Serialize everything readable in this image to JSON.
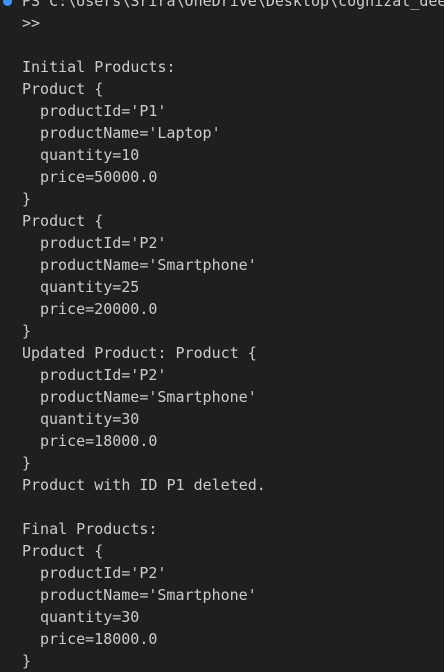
{
  "theme": {
    "background": "#1f1f1f",
    "foreground": "#cccccc",
    "command_decoration": "#3794ff"
  },
  "terminal": {
    "lines": [
      {
        "text": "PS C:\\Users\\Srira\\OneDrive\\Desktop\\cognizat_dee",
        "indent": false,
        "kind": "prompt"
      },
      {
        "text": ">>",
        "indent": false,
        "kind": "prompt"
      },
      {
        "text": "",
        "indent": false,
        "kind": "blank"
      },
      {
        "text": "Initial Products:",
        "indent": false,
        "kind": "output"
      },
      {
        "text": "Product {",
        "indent": false,
        "kind": "output"
      },
      {
        "text": "productId='P1'",
        "indent": true,
        "kind": "output"
      },
      {
        "text": "productName='Laptop'",
        "indent": true,
        "kind": "output"
      },
      {
        "text": "quantity=10",
        "indent": true,
        "kind": "output"
      },
      {
        "text": "price=50000.0",
        "indent": true,
        "kind": "output"
      },
      {
        "text": "}",
        "indent": false,
        "kind": "output"
      },
      {
        "text": "Product {",
        "indent": false,
        "kind": "output"
      },
      {
        "text": "productId='P2'",
        "indent": true,
        "kind": "output"
      },
      {
        "text": "productName='Smartphone'",
        "indent": true,
        "kind": "output"
      },
      {
        "text": "quantity=25",
        "indent": true,
        "kind": "output"
      },
      {
        "text": "price=20000.0",
        "indent": true,
        "kind": "output"
      },
      {
        "text": "}",
        "indent": false,
        "kind": "output"
      },
      {
        "text": "Updated Product: Product {",
        "indent": false,
        "kind": "output"
      },
      {
        "text": "productId='P2'",
        "indent": true,
        "kind": "output"
      },
      {
        "text": "productName='Smartphone'",
        "indent": true,
        "kind": "output"
      },
      {
        "text": "quantity=30",
        "indent": true,
        "kind": "output"
      },
      {
        "text": "price=18000.0",
        "indent": true,
        "kind": "output"
      },
      {
        "text": "}",
        "indent": false,
        "kind": "output"
      },
      {
        "text": "Product with ID P1 deleted.",
        "indent": false,
        "kind": "output"
      },
      {
        "text": "",
        "indent": false,
        "kind": "blank"
      },
      {
        "text": "Final Products:",
        "indent": false,
        "kind": "output"
      },
      {
        "text": "Product {",
        "indent": false,
        "kind": "output"
      },
      {
        "text": "productId='P2'",
        "indent": true,
        "kind": "output"
      },
      {
        "text": "productName='Smartphone'",
        "indent": true,
        "kind": "output"
      },
      {
        "text": "quantity=30",
        "indent": true,
        "kind": "output"
      },
      {
        "text": "price=18000.0",
        "indent": true,
        "kind": "output"
      },
      {
        "text": "}",
        "indent": false,
        "kind": "output"
      }
    ]
  }
}
